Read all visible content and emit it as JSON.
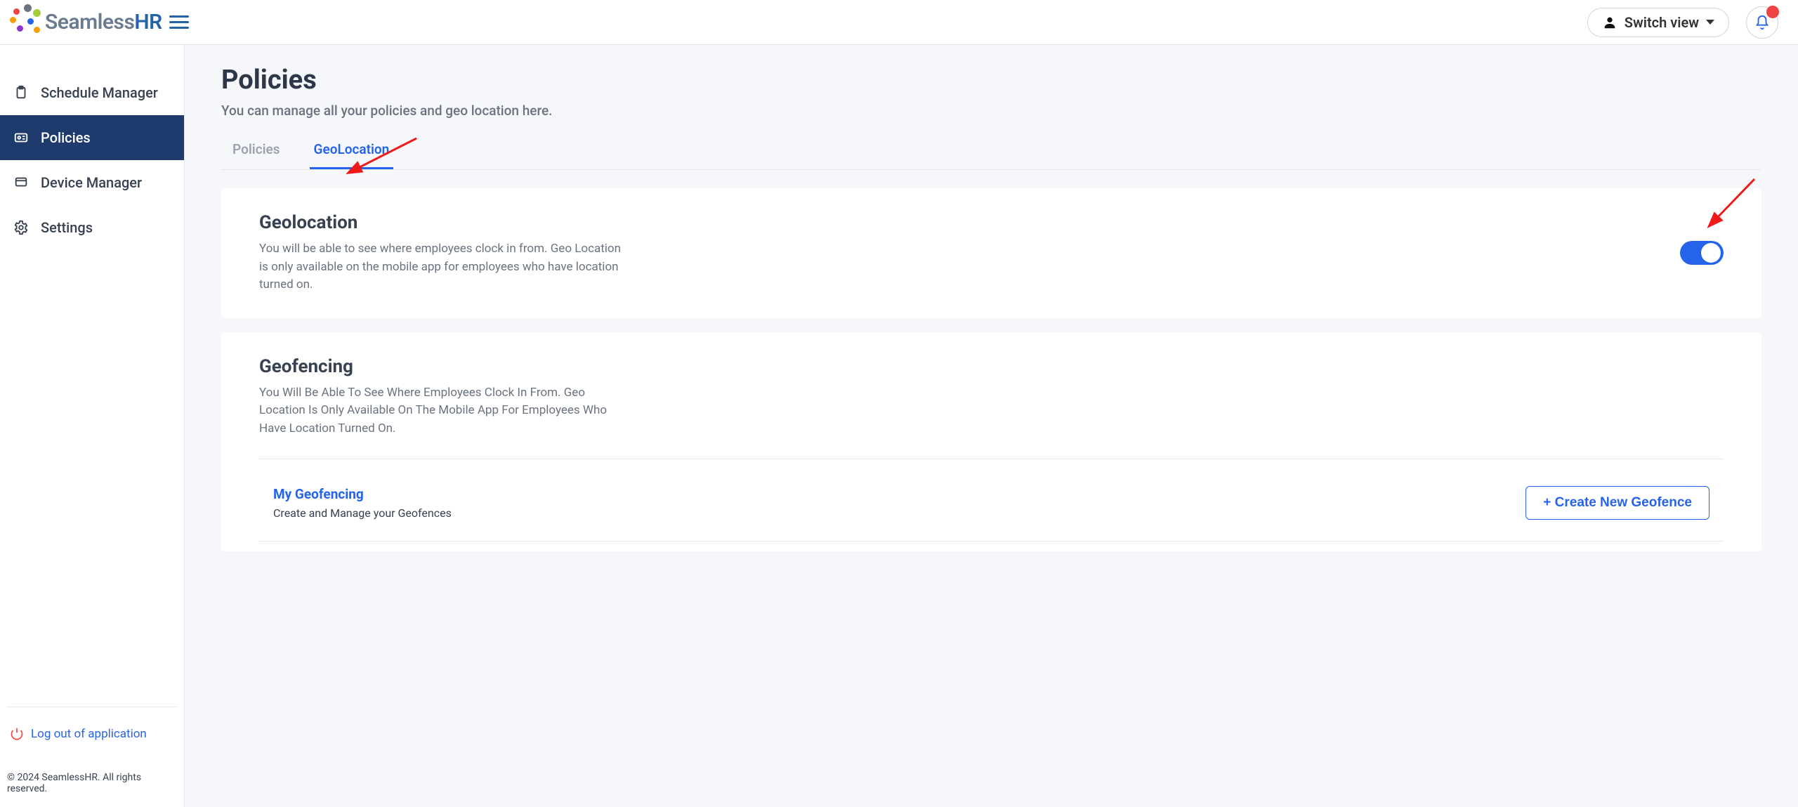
{
  "brand": {
    "seamless": "Seamless",
    "hr": "HR"
  },
  "header": {
    "switch_view_label": "Switch view"
  },
  "sidebar": {
    "items": [
      {
        "label": "Schedule Manager",
        "active": false
      },
      {
        "label": "Policies",
        "active": true
      },
      {
        "label": "Device Manager",
        "active": false
      },
      {
        "label": "Settings",
        "active": false
      }
    ],
    "logout_label": "Log out of application",
    "copyright": "© 2024 SeamlessHR. All rights reserved."
  },
  "page": {
    "title": "Policies",
    "subtitle": "You can manage all your policies and geo location here."
  },
  "tabs": [
    {
      "label": "Policies",
      "active": false
    },
    {
      "label": "GeoLocation",
      "active": true
    }
  ],
  "geolocation_card": {
    "title": "Geolocation",
    "description": "You will be able to see where employees clock in from. Geo Location is only available on the mobile app for employees who have location turned on.",
    "enabled": true
  },
  "geofencing_card": {
    "title": "Geofencing",
    "description": "You Will Be Able To See Where Employees Clock In From. Geo Location Is Only Available On The Mobile App For Employees Who Have Location Turned On.",
    "my_title": "My Geofencing",
    "my_desc": "Create and Manage your Geofences",
    "create_button": "+ Create New Geofence"
  }
}
